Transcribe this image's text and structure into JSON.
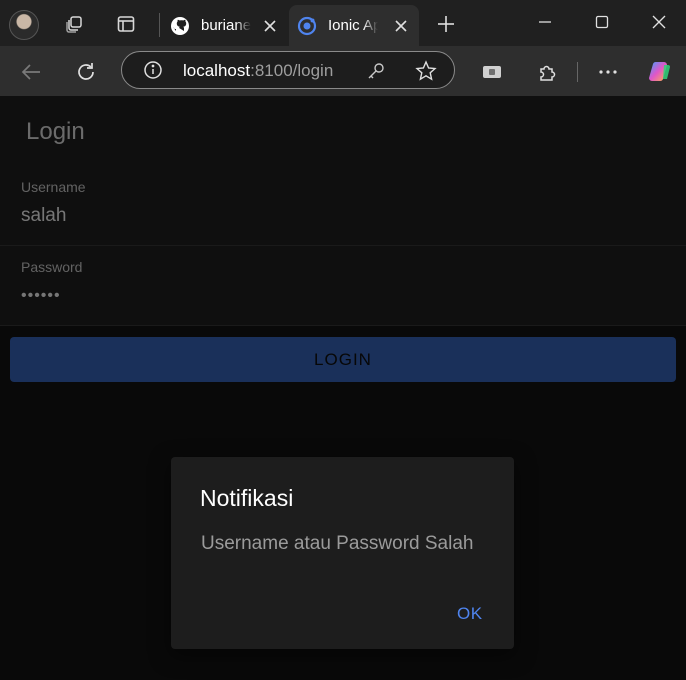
{
  "browser": {
    "tabs": [
      {
        "title": "buriane/",
        "favicon": "github-icon",
        "active": false
      },
      {
        "title": "Ionic Ap",
        "favicon": "ionic-icon",
        "active": true
      }
    ],
    "address": {
      "host": "localhost",
      "path": ":8100/login"
    }
  },
  "app": {
    "header_title": "Login",
    "fields": [
      {
        "label": "Username",
        "value": "salah"
      },
      {
        "label": "Password",
        "value": "••••••"
      }
    ],
    "login_button": "LOGIN"
  },
  "alert": {
    "title": "Notifikasi",
    "message": "Username atau Password Salah",
    "ok_label": "OK"
  },
  "colors": {
    "accent": "#4f84ee",
    "button": "#3461b4",
    "background": "#121212"
  }
}
